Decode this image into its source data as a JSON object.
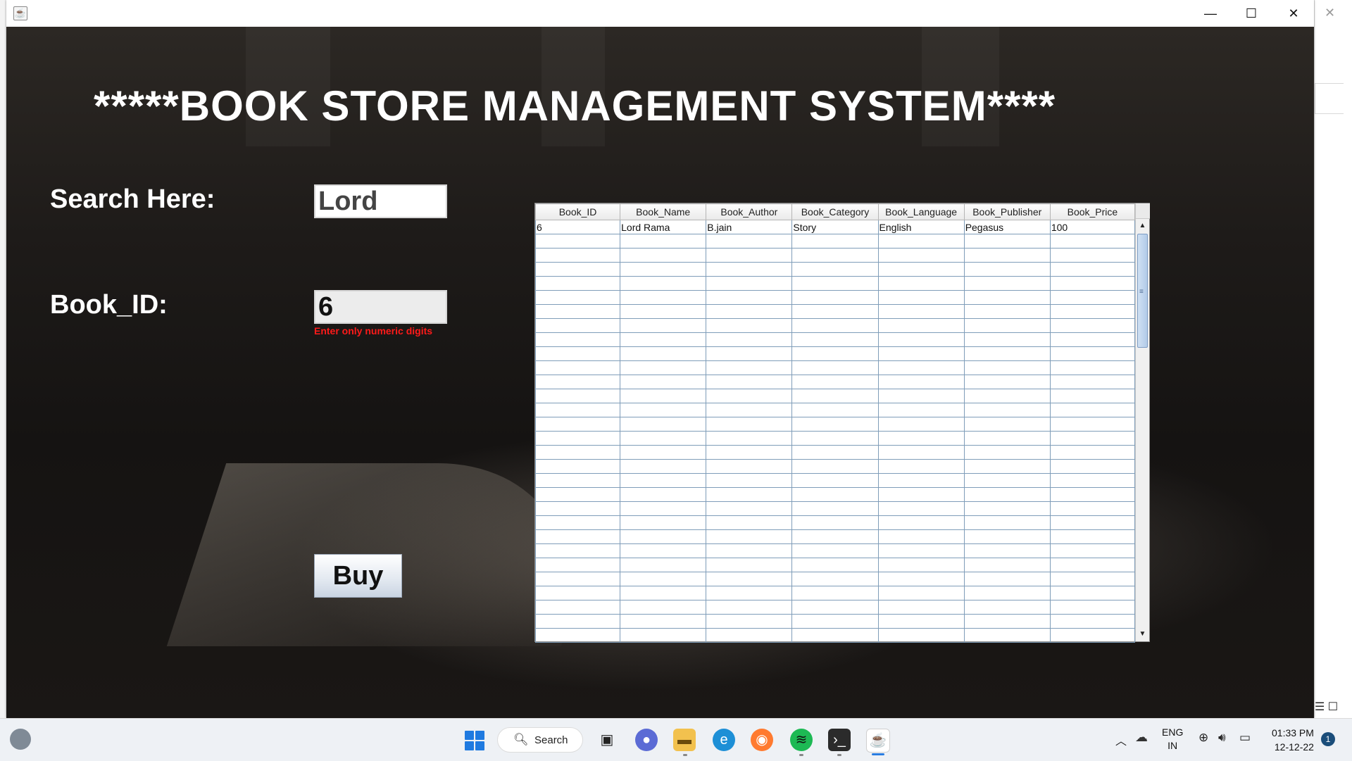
{
  "window": {
    "minimize_glyph": "—",
    "maximize_glyph": "☐",
    "close_glyph": "✕"
  },
  "app": {
    "title": "*****BOOK STORE MANAGEMENT SYSTEM****",
    "search_label": "Search Here:",
    "search_value": "Lord",
    "bookid_label": "Book_ID:",
    "bookid_value": "6",
    "bookid_hint": "Enter only numeric digits",
    "buy_label": "Buy"
  },
  "table": {
    "columns": [
      "Book_ID",
      "Book_Name",
      "Book_Author",
      "Book_Category",
      "Book_Language",
      "Book_Publisher",
      "Book_Price"
    ],
    "rows": [
      [
        "6",
        "Lord Rama",
        "B.jain",
        "Story",
        "English",
        "Pegasus",
        "100"
      ]
    ],
    "empty_rows": 29
  },
  "taskbar": {
    "search_label": "Search",
    "lang_line1": "ENG",
    "lang_line2": "IN",
    "time": "01:33 PM",
    "date": "12-12-22",
    "notification_count": "1"
  },
  "colors": {
    "hint": "#ff1a1a",
    "title": "#ffffff",
    "grid": "#7f9db9",
    "accent": "#2a7de1"
  }
}
